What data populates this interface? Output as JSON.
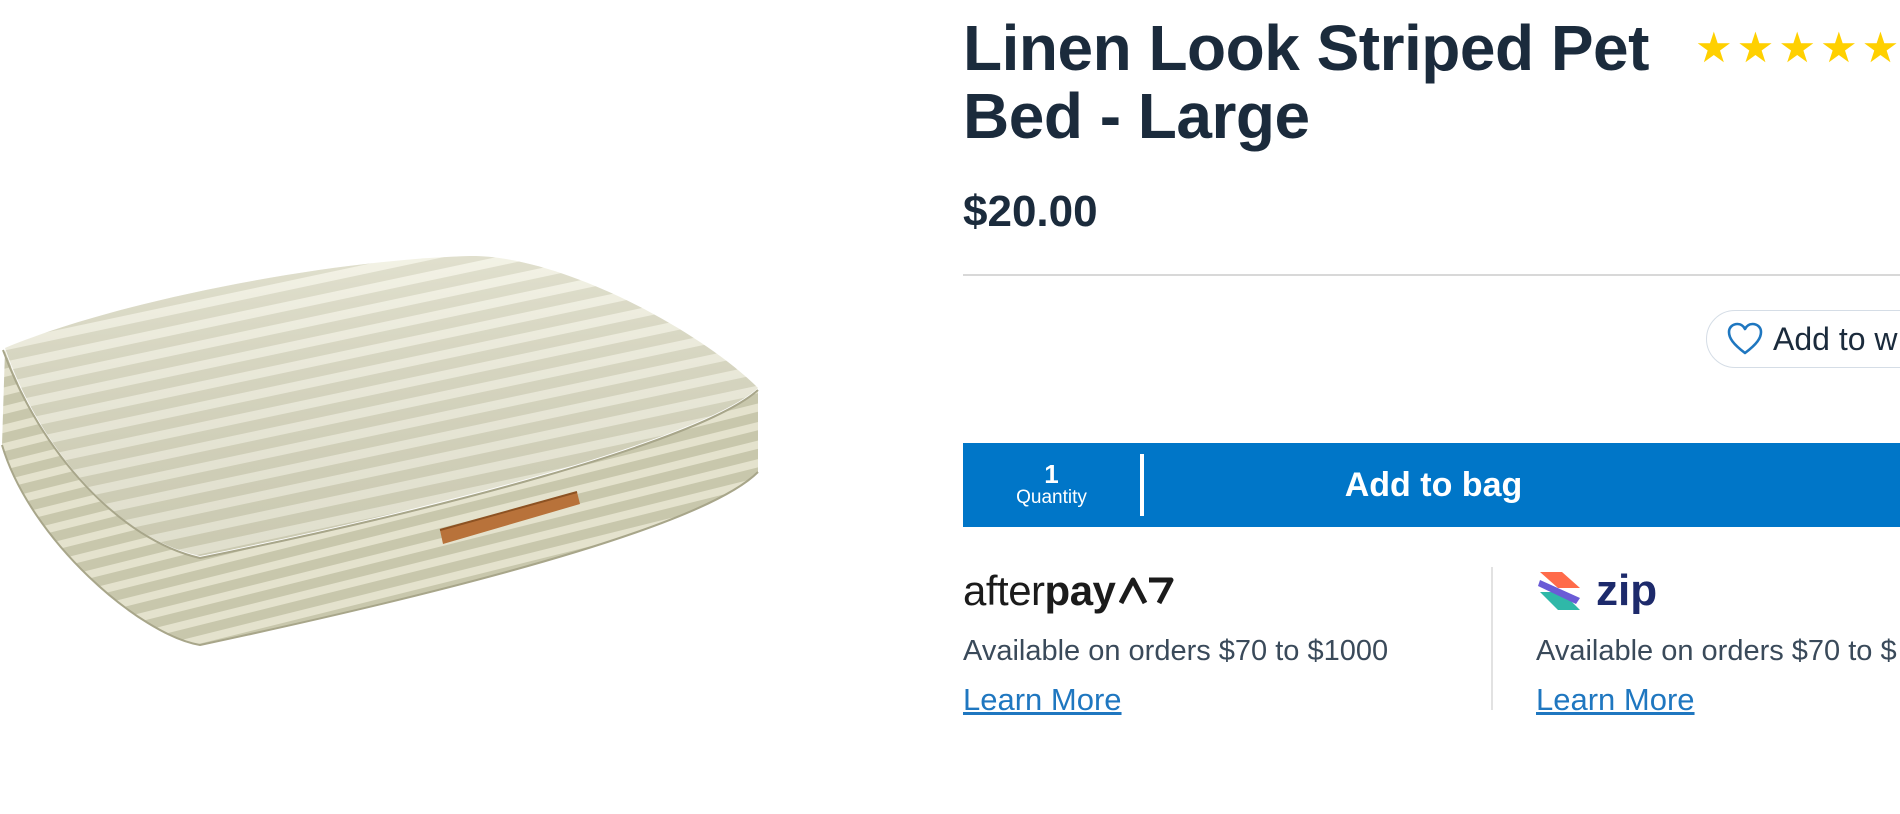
{
  "product": {
    "title": "Linen Look Striped Pet Bed - Large",
    "price": "$20.00",
    "rating": {
      "stars": 5,
      "glyph": "★"
    },
    "image_alt": "Striped pet bed product image"
  },
  "wishlist": {
    "label": "Add to w"
  },
  "purchase": {
    "quantity_value": "1",
    "quantity_label": "Quantity",
    "add_to_bag_label": "Add to bag"
  },
  "payments": {
    "afterpay": {
      "logo_light": "after",
      "logo_bold": "pay",
      "text": "Available on orders $70 to $1000",
      "link": "Learn More"
    },
    "zip": {
      "logo": "zip",
      "text": "Available on orders $70 to $",
      "link": "Learn More"
    }
  },
  "colors": {
    "brand_blue": "#0076c8",
    "title_navy": "#1b2b3c",
    "star_yellow": "#ffd000",
    "link_blue": "#1f77c0"
  }
}
